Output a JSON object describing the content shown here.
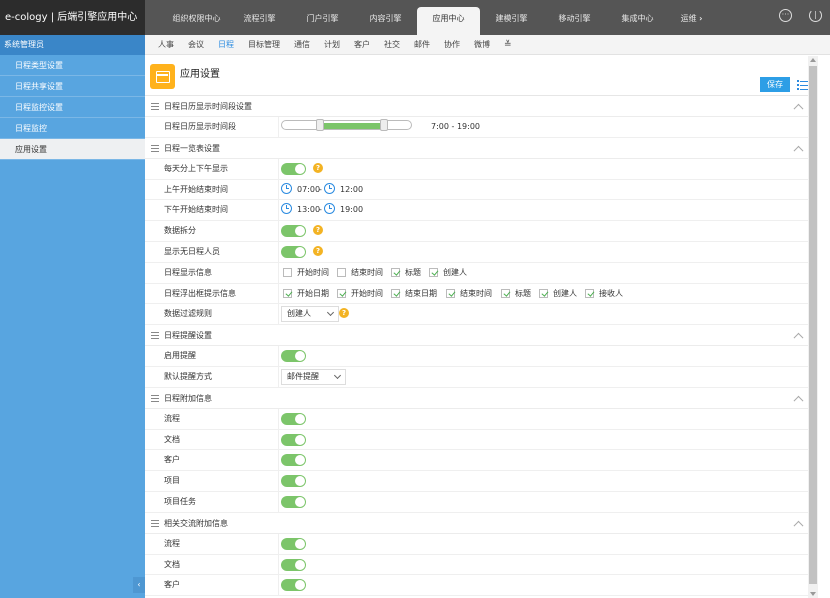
{
  "app": {
    "title": "e-cology | 后端引擎应用中心"
  },
  "topnav": {
    "tabs": [
      "组织权限中心",
      "流程引擎",
      "门户引擎",
      "内容引擎",
      "应用中心",
      "建模引擎",
      "移动引擎",
      "集成中心",
      "运维"
    ],
    "active": "应用中心",
    "more_icon": "chevron-right-icon"
  },
  "sidebar": {
    "header": "系统管理员",
    "items": [
      "日程类型设置",
      "日程共享设置",
      "日程监控设置",
      "日程监控",
      "应用设置"
    ],
    "active": "应用设置"
  },
  "subnav": {
    "tabs": [
      "人事",
      "会议",
      "日程",
      "目标管理",
      "通信",
      "计划",
      "客户",
      "社交",
      "邮件",
      "协作",
      "微博"
    ],
    "active": "日程"
  },
  "page": {
    "title": "应用设置",
    "save_label": "保存"
  },
  "sections": {
    "s1": {
      "title": "日程日历显示时间段设置",
      "row_label": "日程日历显示时间段",
      "range_text": "7:00 - 19:00",
      "range_start_hour": 7,
      "range_end_hour": 19
    },
    "s2": {
      "title": "日程一览表设置",
      "rows": {
        "ampm": "每天分上下午显示",
        "am_time": "上午开始结束时间",
        "pm_time": "下午开始结束时间",
        "split": "数据拆分",
        "show_no": "显示无日程人员",
        "display": "日程显示信息",
        "float": "日程浮出框提示信息",
        "filter": "数据过滤规则"
      },
      "am_start": "07:00",
      "am_sep": "-",
      "am_end": "12:00",
      "pm_start": "13:00",
      "pm_sep": "-",
      "pm_end": "19:00",
      "display_opts": [
        "开始时间",
        "结束时间",
        "标题",
        "创建人"
      ],
      "float_opts": [
        "开始日期",
        "开始时间",
        "结束日期",
        "结束时间",
        "标题",
        "创建人",
        "接收人"
      ],
      "filter_value": "创建人"
    },
    "s3": {
      "title": "日程提醒设置",
      "enable": "启用提醒",
      "method": "默认提醒方式",
      "method_value": "邮件提醒"
    },
    "s4": {
      "title": "日程附加信息",
      "items": [
        "流程",
        "文档",
        "客户",
        "项目",
        "项目任务"
      ]
    },
    "s5": {
      "title": "相关交流附加信息",
      "items": [
        "流程",
        "文档",
        "客户"
      ]
    }
  },
  "colors": {
    "accent": "#2d9ee6",
    "toggle_on": "#7cc56a",
    "help": "#f3b323",
    "sidebar": "#58a5e0",
    "topbar": "#555555"
  }
}
